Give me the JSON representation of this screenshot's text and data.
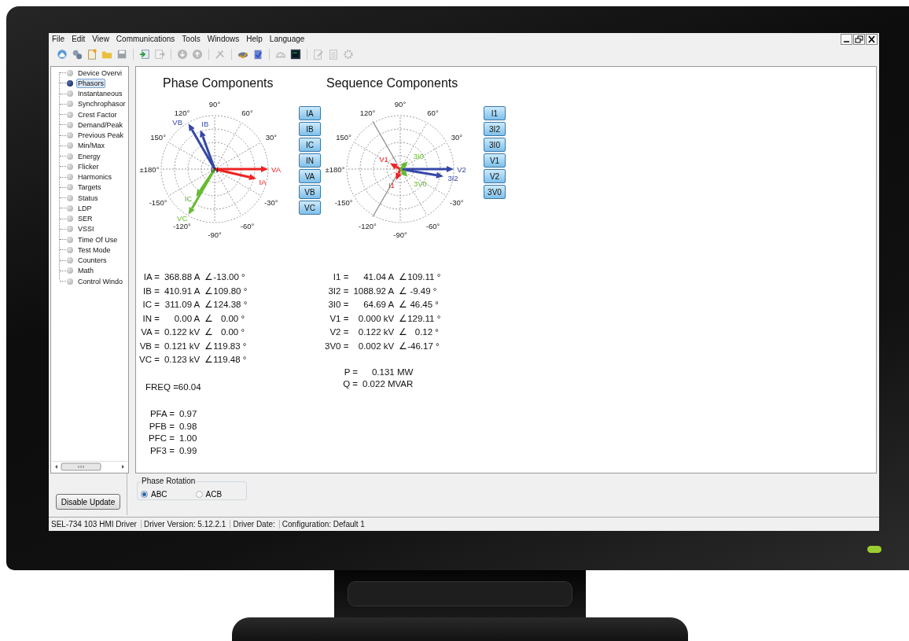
{
  "menu": [
    "File",
    "Edit",
    "View",
    "Communications",
    "Tools",
    "Windows",
    "Help",
    "Language"
  ],
  "tree": [
    {
      "label": "Device Overvi",
      "selected": false
    },
    {
      "label": "Phasors",
      "selected": true
    },
    {
      "label": "Instantaneous",
      "selected": false
    },
    {
      "label": "Synchrophasor",
      "selected": false
    },
    {
      "label": "Crest Factor",
      "selected": false
    },
    {
      "label": "Demand/Peak",
      "selected": false
    },
    {
      "label": "Previous Peak",
      "selected": false
    },
    {
      "label": "Min/Max",
      "selected": false
    },
    {
      "label": "Energy",
      "selected": false
    },
    {
      "label": "Flicker",
      "selected": false
    },
    {
      "label": "Harmonics",
      "selected": false
    },
    {
      "label": "Targets",
      "selected": false
    },
    {
      "label": "Status",
      "selected": false
    },
    {
      "label": "LDP",
      "selected": false
    },
    {
      "label": "SER",
      "selected": false
    },
    {
      "label": "VSSI",
      "selected": false
    },
    {
      "label": "Time Of Use",
      "selected": false
    },
    {
      "label": "Test Mode",
      "selected": false
    },
    {
      "label": "Counters",
      "selected": false
    },
    {
      "label": "Math",
      "selected": false
    },
    {
      "label": "Control Windo",
      "selected": false
    }
  ],
  "phase": {
    "title": "Phase Components",
    "center_label": "IN",
    "angle_labels": [
      "90°",
      "60°",
      "30°",
      "-30°",
      "-60°",
      "-90°",
      "-120°",
      "-150°",
      "±180°",
      "150°",
      "120°"
    ],
    "vectors": [
      {
        "label": "VA",
        "color": "#ee2222"
      },
      {
        "label": "IA",
        "color": "#ee2222"
      },
      {
        "label": "VB",
        "color": "#3548a8"
      },
      {
        "label": "IB",
        "color": "#3548a8"
      },
      {
        "label": "IC",
        "color": "#66bb33"
      },
      {
        "label": "VC",
        "color": "#66bb33"
      }
    ],
    "buttons": [
      "IA",
      "IB",
      "IC",
      "IN",
      "VA",
      "VB",
      "VC"
    ],
    "readouts": [
      {
        "label": "IA =",
        "value": "368.88 A",
        "angle": "∠-13.00 °"
      },
      {
        "label": "IB =",
        "value": "410.91 A",
        "angle": "∠109.80 °"
      },
      {
        "label": "IC =",
        "value": "311.09 A",
        "angle": "∠124.38 °"
      },
      {
        "label": "IN =",
        "value": "0.00 A",
        "angle": "∠   0.00 °"
      },
      {
        "label": "VA =",
        "value": "0.122 kV",
        "angle": "∠   0.00 °"
      },
      {
        "label": "VB =",
        "value": "0.121 kV",
        "angle": "∠119.83 °"
      },
      {
        "label": "VC =",
        "value": "0.123 kV",
        "angle": "∠119.48 °"
      }
    ],
    "freq": "FREQ =60.04",
    "power_factors": [
      {
        "label": "PFA =",
        "value": "0.97"
      },
      {
        "label": "PFB =",
        "value": "0.98"
      },
      {
        "label": "PFC =",
        "value": "1.00"
      },
      {
        "label": "PF3 =",
        "value": "0.99"
      }
    ]
  },
  "sequence": {
    "title": "Sequence Components",
    "angle_labels": [
      "90°",
      "60°",
      "30°",
      "-30°",
      "-60°",
      "-90°",
      "-120°",
      "-150°",
      "±180°",
      "150°",
      "120°"
    ],
    "vectors": [
      {
        "label": "V2",
        "color": "#3548a8"
      },
      {
        "label": "3I2",
        "color": "#3548a8"
      },
      {
        "label": "V1",
        "color": "#ee2222"
      },
      {
        "label": "I1",
        "color": "#ee2222"
      },
      {
        "label": "3I0",
        "color": "#66bb33"
      },
      {
        "label": "3V0",
        "color": "#66bb33"
      }
    ],
    "buttons": [
      "I1",
      "3I2",
      "3I0",
      "V1",
      "V2",
      "3V0"
    ],
    "readouts": [
      {
        "label": "I1 =",
        "value": "41.04 A",
        "angle": "∠109.11 °"
      },
      {
        "label": "3I2 =",
        "value": "1088.92 A",
        "angle": "∠ -9.49 °"
      },
      {
        "label": "3I0 =",
        "value": "64.69 A",
        "angle": "∠ 46.45 °"
      },
      {
        "label": "V1 =",
        "value": "0.000 kV",
        "angle": "∠129.11 °"
      },
      {
        "label": "V2 =",
        "value": "0.122 kV",
        "angle": "∠   0.12 °"
      },
      {
        "label": "3V0 =",
        "value": "0.002 kV",
        "angle": "∠-46.17 °"
      }
    ],
    "power": [
      {
        "label": "P =",
        "value": "0.131 MW"
      },
      {
        "label": "Q =",
        "value": "0.022 MVAR"
      }
    ]
  },
  "disable_button": "Disable Update",
  "phase_rotation": {
    "title": "Phase Rotation",
    "options": [
      {
        "label": "ABC",
        "selected": true
      },
      {
        "label": "ACB",
        "selected": false
      }
    ]
  },
  "status_bar": [
    "SEL-734 103 HMI Driver",
    "Driver Version: 5.12.2.1",
    "Driver Date:",
    "Configuration: Default 1"
  ]
}
